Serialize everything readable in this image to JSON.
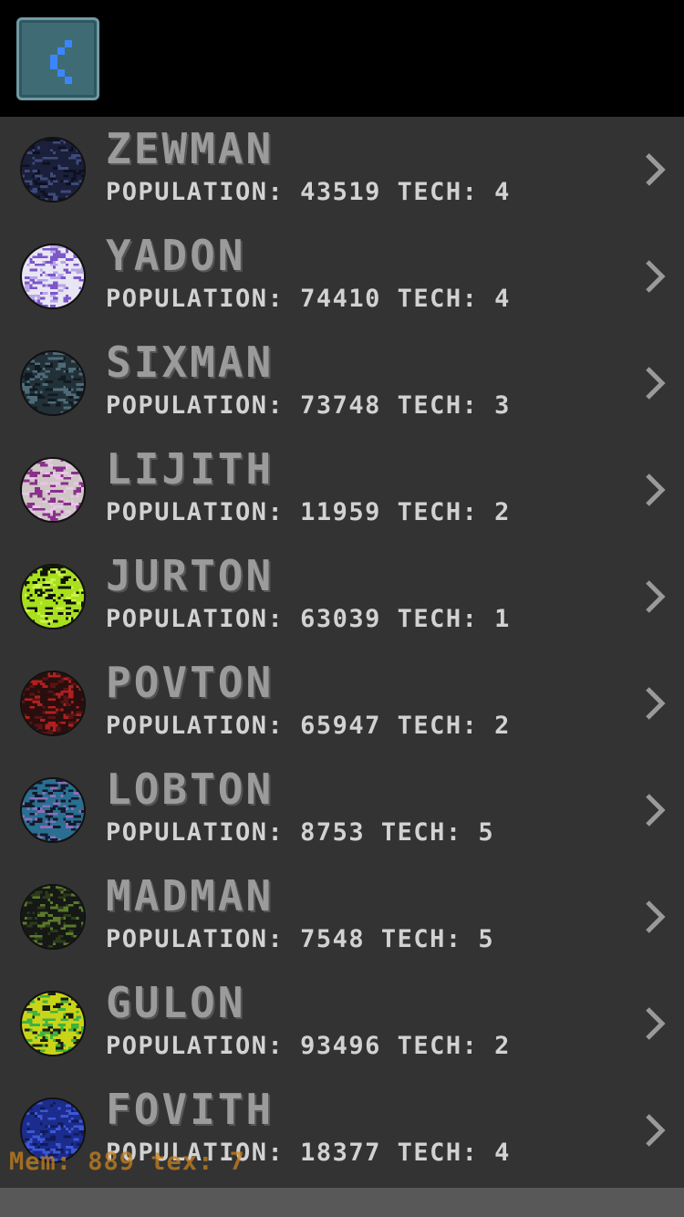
{
  "header": {
    "back_icon": "chevron-left-icon"
  },
  "planets": [
    {
      "name": "ZEWMAN",
      "population_label": "POPULATION:",
      "population": "43519",
      "tech_label": "TECH:",
      "tech": "4",
      "colors": [
        "#1a1f3a",
        "#3d4a7a",
        "#0e1020"
      ]
    },
    {
      "name": "YADON",
      "population_label": "POPULATION:",
      "population": "74410",
      "tech_label": "TECH:",
      "tech": "4",
      "colors": [
        "#e8e6f4",
        "#7b57c9",
        "#b7a6e6"
      ]
    },
    {
      "name": "SIXMAN",
      "population_label": "POPULATION:",
      "population": "73748",
      "tech_label": "TECH:",
      "tech": "3",
      "colors": [
        "#223038",
        "#4e6b78",
        "#111a20"
      ]
    },
    {
      "name": "LIJITH",
      "population_label": "POPULATION:",
      "population": "11959",
      "tech_label": "TECH:",
      "tech": "2",
      "colors": [
        "#cfc6c6",
        "#8a2f8c",
        "#e9c6ea"
      ]
    },
    {
      "name": "JURTON",
      "population_label": "POPULATION:",
      "population": "63039",
      "tech_label": "TECH:",
      "tech": "1",
      "colors": [
        "#a8e01d",
        "#101407",
        "#cdf24a"
      ]
    },
    {
      "name": "POVTON",
      "population_label": "POPULATION:",
      "population": "65947",
      "tech_label": "TECH:",
      "tech": "2",
      "colors": [
        "#2a0e0e",
        "#b02020",
        "#5a1414"
      ]
    },
    {
      "name": "LOBTON",
      "population_label": "POPULATION:",
      "population": "8753",
      "tech_label": "TECH:",
      "tech": "5",
      "colors": [
        "#2a6e92",
        "#121a2a",
        "#8c6fb8"
      ]
    },
    {
      "name": "MADMAN",
      "population_label": "POPULATION:",
      "population": "7548",
      "tech_label": "TECH:",
      "tech": "5",
      "colors": [
        "#151815",
        "#5c7a2a",
        "#2c3a1a"
      ]
    },
    {
      "name": "GULON",
      "population_label": "POPULATION:",
      "population": "93496",
      "tech_label": "TECH:",
      "tech": "2",
      "colors": [
        "#c9d418",
        "#3fb13f",
        "#1c1c0a"
      ]
    },
    {
      "name": "FOVITH",
      "population_label": "POPULATION:",
      "population": "18377",
      "tech_label": "TECH:",
      "tech": "4",
      "colors": [
        "#1c2c8c",
        "#3d58d6",
        "#101a5a"
      ]
    }
  ],
  "row_icon": "chevron-right-icon",
  "debug_overlay": "Mem: 889 tex: 7"
}
